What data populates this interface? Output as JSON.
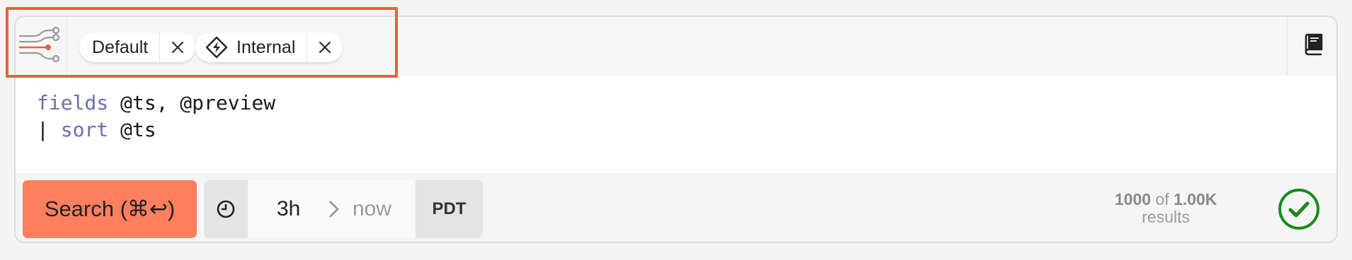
{
  "filters": {
    "chips": [
      {
        "label": "Default",
        "icon": "none"
      },
      {
        "label": "Internal",
        "icon": "lightning-diamond-icon"
      }
    ]
  },
  "query": {
    "line1": {
      "keyword": "fields",
      "rest": " @ts, @preview"
    },
    "line2": {
      "pipe": "| ",
      "keyword": "sort",
      "rest": " @ts"
    }
  },
  "search": {
    "label": "Search (⌘↩)"
  },
  "time_range": {
    "start": "3h",
    "end": "now",
    "timezone": "PDT"
  },
  "results": {
    "shown": "1000",
    "of_text": "of",
    "total": "1.00K",
    "label": "results"
  },
  "colors": {
    "accent": "#ff7f5e",
    "highlight": "#e8603f",
    "success": "#1a8a1a",
    "keyword": "#6a6fae"
  }
}
